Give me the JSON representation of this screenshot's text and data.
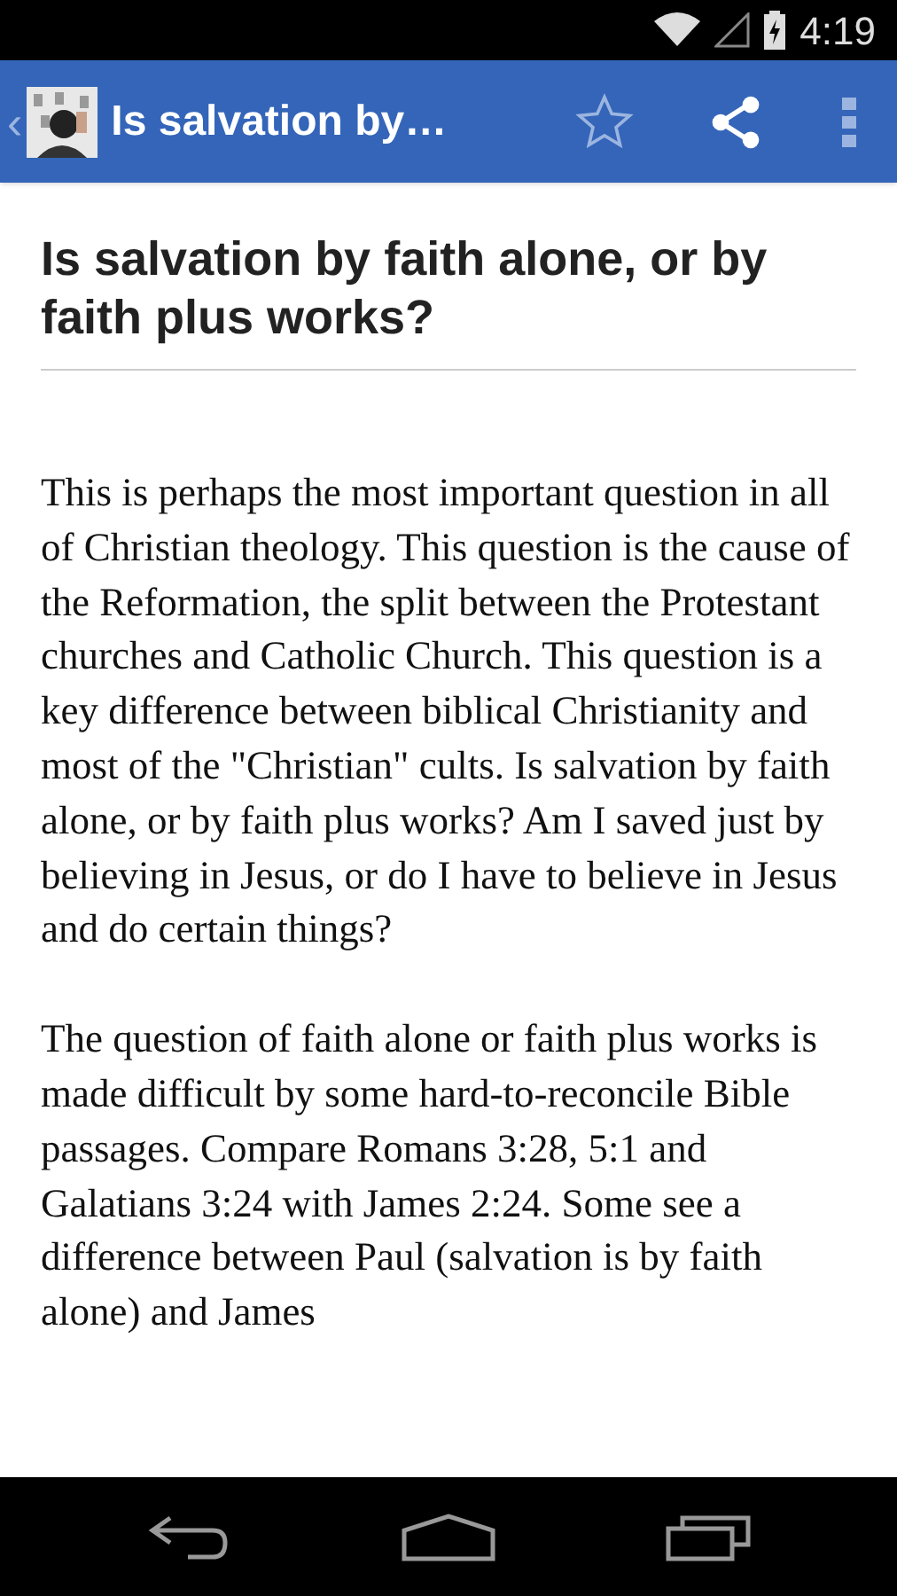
{
  "status_bar": {
    "time": "4:19"
  },
  "app_bar": {
    "title": "Is salvation by…",
    "back": "‹"
  },
  "article": {
    "heading": "Is salvation by faith alone, or by faith plus works?",
    "paragraphs": [
      "This is perhaps the most important question in all of Christian theology. This question is the cause of the Reformation, the split between the Protestant churches and Catholic Church. This question is a key difference between biblical Christianity and most of the \"Christian\" cults. Is salvation by faith alone, or by faith plus works? Am I saved just by believing in Jesus, or do I have to believe in Jesus and do certain things?",
      "The question of faith alone or faith plus works is made difficult by some hard-to-reconcile Bible passages. Compare Romans 3:28, 5:1 and Galatians 3:24 with James 2:24. Some see a difference between Paul (salvation is by faith alone) and James"
    ]
  }
}
